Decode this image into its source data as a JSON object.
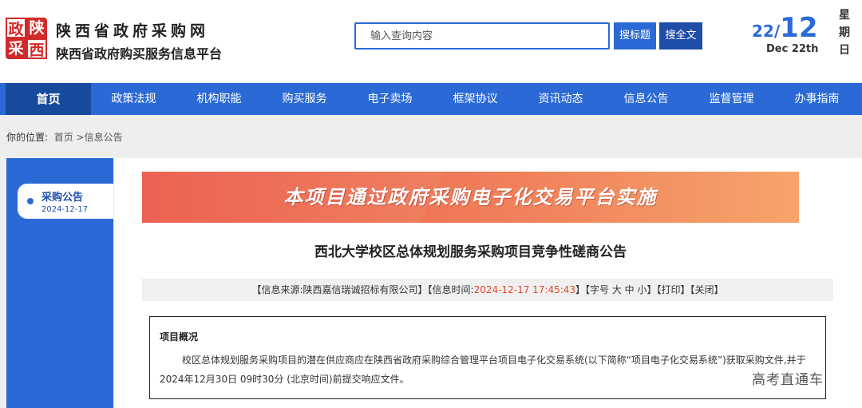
{
  "header": {
    "logo": [
      "政",
      "陕",
      "采",
      "西"
    ],
    "site_title": "陕西省政府采购网",
    "site_subtitle": "陕西省政府购买服务信息平台",
    "search": {
      "placeholder": "输入查询内容",
      "btn_bid": "搜标题",
      "btn_all": "搜全文"
    },
    "date": {
      "month": "22",
      "slash": "/",
      "day": "12",
      "english": "Dec 22th",
      "weekday": "星期日"
    }
  },
  "nav": {
    "items": [
      "首页",
      "政策法规",
      "机构职能",
      "购买服务",
      "电子卖场",
      "框架协议",
      "资讯动态",
      "信息公告",
      "监督管理",
      "办事指南"
    ],
    "active": "首页"
  },
  "breadcrumb": {
    "label": "你的位置:",
    "home": "首页",
    "sep": ">",
    "current": "信息公告"
  },
  "sidebar": {
    "title": "采购公告",
    "date": "2024-12-17"
  },
  "banner": {
    "text": "本项目通过政府采购电子化交易平台实施"
  },
  "article": {
    "title": "西北大学校区总体规划服务采购项目竞争性磋商公告",
    "meta": {
      "source_prefix": "【信息来源:陕西嘉信瑞诚招标有限公司】【信息时间:",
      "time": "2024-12-17 17:45:43",
      "suffix": "】【字号 大 中 小】【打印】【关闭】"
    },
    "section_title": "项目概况",
    "paragraph": "校区总体规划服务采购项目的潜在供应商应在陕西省政府采购综合管理平台项目电子化交易系统(以下简称“项目电子化交易系统”)获取采购文件,并于 2024年12月30日 09时30分 (北京时间)前提交响应文件。"
  },
  "watermark": "高考直通车",
  "colors": {
    "brand_blue": "#2b6ad6",
    "nav_active": "#174a9c",
    "logo_red": "#d22a2a",
    "time_red": "#e0462c"
  }
}
